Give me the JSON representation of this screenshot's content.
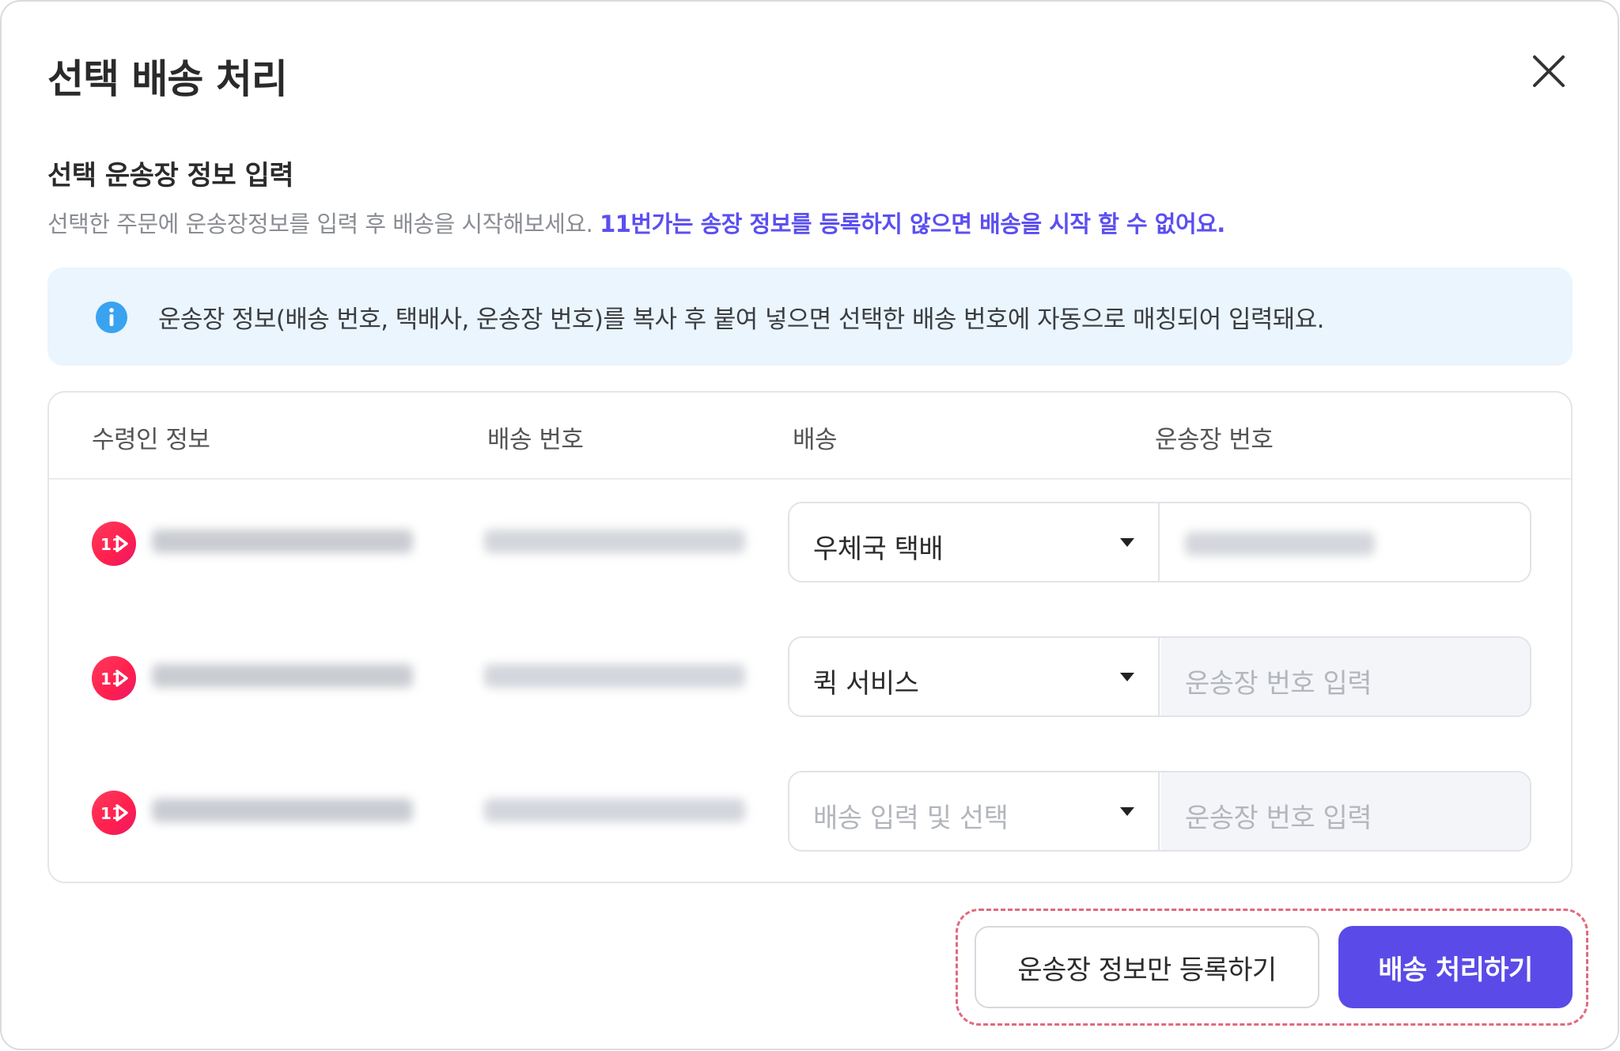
{
  "modal": {
    "title": "선택 배송 처리",
    "close_icon": "close-icon"
  },
  "section": {
    "title": "선택 운송장 정보 입력",
    "description": "선택한 주문에 운송장정보를 입력 후 배송을 시작해보세요. ",
    "description_highlight": "11번가는 송장 정보를 등록하지 않으면 배송을 시작 할 수 없어요."
  },
  "notice": {
    "icon": "info-icon",
    "text": "운송장 정보(배송 번호, 택배사, 운송장 번호)를 복사 후 붙여 넣으면 선택한 배송 번호에 자동으로 매칭되어 입력돼요."
  },
  "table": {
    "headers": [
      "수령인 정보",
      "배송 번호",
      "배송",
      "운송장 번호"
    ],
    "rows": [
      {
        "store_logo": "11st-logo",
        "carrier": "우체국 택배",
        "carrier_is_placeholder": false,
        "tracking_placeholder": ""
      },
      {
        "store_logo": "11st-logo",
        "carrier": "퀵 서비스",
        "carrier_is_placeholder": false,
        "tracking_placeholder": "운송장 번호 입력"
      },
      {
        "store_logo": "11st-logo",
        "carrier": "배송 입력 및 선택",
        "carrier_is_placeholder": true,
        "tracking_placeholder": "운송장 번호 입력"
      }
    ]
  },
  "footer": {
    "register_only_label": "운송장 정보만 등록하기",
    "process_label": "배송 처리하기"
  },
  "colors": {
    "accent": "#5a4be8",
    "highlight_link": "#5b4ff0",
    "notice_bg": "#eaf5fd",
    "info_icon": "#3aa3f0",
    "store_logo": "#ff2d55",
    "dashed_highlight": "#e06a7f"
  }
}
